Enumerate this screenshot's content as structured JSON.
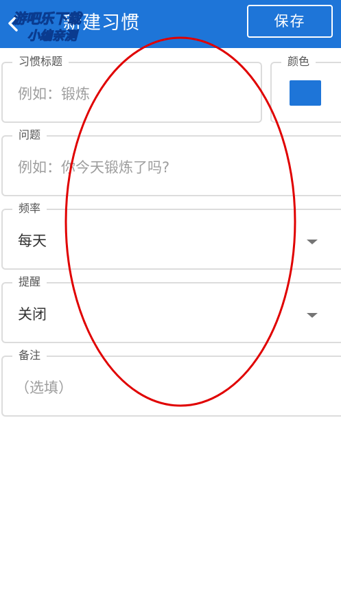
{
  "app_bar": {
    "title": "新建习惯",
    "save_label": "保存"
  },
  "watermark": {
    "line1": "游吧乐下载",
    "line2": "小编亲测"
  },
  "form": {
    "habit_title": {
      "label": "习惯标题",
      "placeholder": "例如：锻炼"
    },
    "color": {
      "label": "颜色",
      "value": "#1e75d8"
    },
    "question": {
      "label": "问题",
      "placeholder": "例如：你今天锻炼了吗?"
    },
    "frequency": {
      "label": "频率",
      "value": "每天"
    },
    "reminder": {
      "label": "提醒",
      "value": "关闭"
    },
    "notes": {
      "label": "备注",
      "placeholder": "（选填）"
    }
  },
  "colors": {
    "app_bar": "#1e75d8",
    "annotation": "#e00000"
  }
}
